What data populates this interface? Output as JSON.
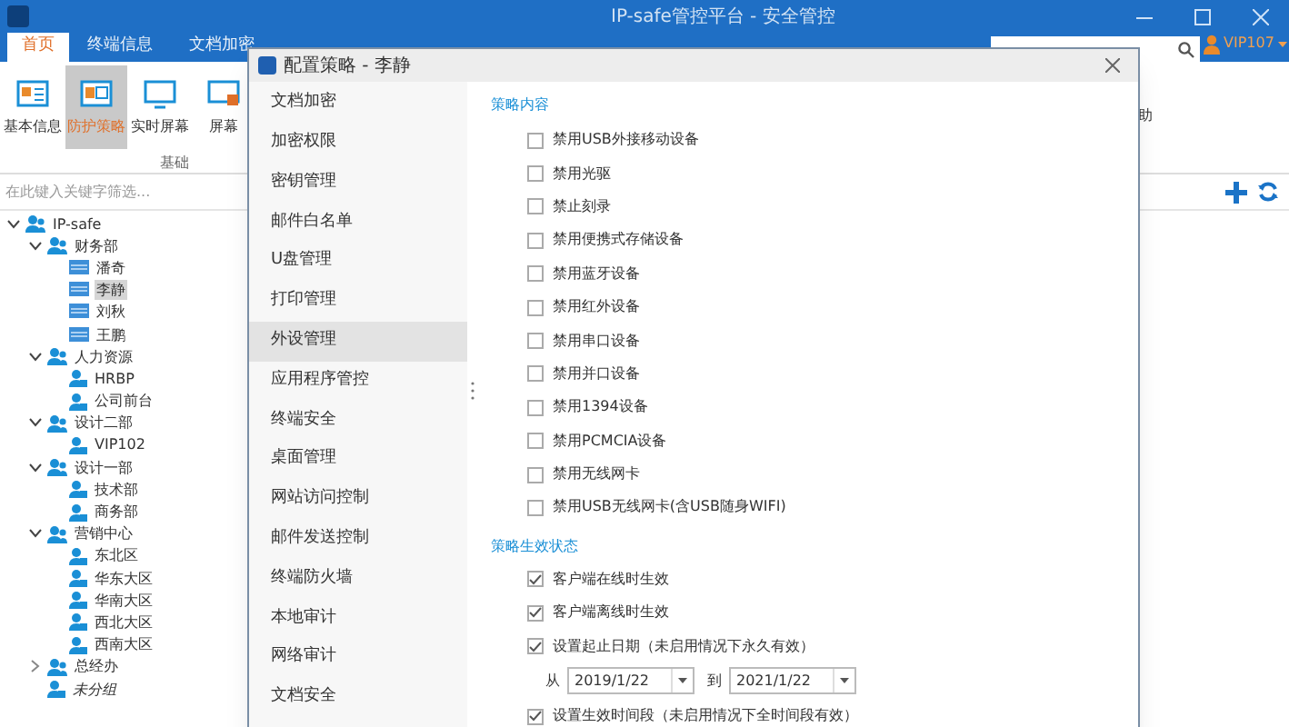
{
  "window": {
    "title": "IP-safe管控平台 - 安全管控",
    "user": "VIP107"
  },
  "tabs": [
    {
      "label": "首页",
      "selected": true
    },
    {
      "label": "终端信息",
      "selected": false
    },
    {
      "label": "文档加密",
      "selected": false
    }
  ],
  "ribbon": {
    "buttons": [
      {
        "label": "基本信息",
        "selected": false,
        "kind": "info"
      },
      {
        "label": "防护策略",
        "selected": true,
        "kind": "policy"
      },
      {
        "label": "实时屏幕",
        "selected": false,
        "kind": "screen"
      },
      {
        "label": "屏幕",
        "selected": false,
        "kind": "screen2"
      }
    ],
    "group_label": "基础",
    "right_button": "助"
  },
  "filter": {
    "placeholder": "在此键入关键字筛选..."
  },
  "tree": [
    {
      "label": "IP-safe",
      "kind": "group",
      "expanded": true,
      "selected": false,
      "children": [
        {
          "label": "财务部",
          "kind": "group",
          "expanded": true,
          "selected": false,
          "children": [
            {
              "label": "潘奇",
              "kind": "terminal",
              "selected": false
            },
            {
              "label": "李静",
              "kind": "terminal",
              "selected": true
            },
            {
              "label": "刘秋",
              "kind": "terminal",
              "selected": false
            },
            {
              "label": "王鹏",
              "kind": "terminal",
              "selected": false
            }
          ]
        },
        {
          "label": "人力资源",
          "kind": "group",
          "expanded": true,
          "selected": false,
          "children": [
            {
              "label": "HRBP",
              "kind": "user",
              "selected": false
            },
            {
              "label": "公司前台",
              "kind": "user",
              "selected": false
            }
          ]
        },
        {
          "label": "设计二部",
          "kind": "group",
          "expanded": true,
          "selected": false,
          "children": [
            {
              "label": "VIP102",
              "kind": "user",
              "selected": false
            }
          ]
        },
        {
          "label": "设计一部",
          "kind": "group",
          "expanded": true,
          "selected": false,
          "children": [
            {
              "label": "技术部",
              "kind": "user",
              "selected": false
            },
            {
              "label": "商务部",
              "kind": "user",
              "selected": false
            }
          ]
        },
        {
          "label": "营销中心",
          "kind": "group",
          "expanded": true,
          "selected": false,
          "children": [
            {
              "label": "东北区",
              "kind": "user",
              "selected": false
            },
            {
              "label": "华东大区",
              "kind": "user",
              "selected": false
            },
            {
              "label": "华南大区",
              "kind": "user",
              "selected": false
            },
            {
              "label": "西北大区",
              "kind": "user",
              "selected": false
            },
            {
              "label": "西南大区",
              "kind": "user",
              "selected": false
            }
          ]
        },
        {
          "label": "总经办",
          "kind": "group",
          "expanded": false,
          "selected": false
        },
        {
          "label": "未分组",
          "kind": "ungrouped",
          "selected": false
        }
      ]
    }
  ],
  "dialog": {
    "title": "配置策略 - 李静",
    "nav": [
      {
        "label": "文档加密",
        "selected": false
      },
      {
        "label": "加密权限",
        "selected": false
      },
      {
        "label": "密钥管理",
        "selected": false
      },
      {
        "label": "邮件白名单",
        "selected": false
      },
      {
        "label": "U盘管理",
        "selected": false
      },
      {
        "label": "打印管理",
        "selected": false
      },
      {
        "label": "外设管理",
        "selected": true
      },
      {
        "label": "应用程序管控",
        "selected": false
      },
      {
        "label": "终端安全",
        "selected": false
      },
      {
        "label": "桌面管理",
        "selected": false
      },
      {
        "label": "网站访问控制",
        "selected": false
      },
      {
        "label": "邮件发送控制",
        "selected": false
      },
      {
        "label": "终端防火墙",
        "selected": false
      },
      {
        "label": "本地审计",
        "selected": false
      },
      {
        "label": "网络审计",
        "selected": false
      },
      {
        "label": "文档安全",
        "selected": false
      }
    ],
    "content_heading": "策略内容",
    "options": [
      {
        "label": "禁用USB外接移动设备",
        "checked": false
      },
      {
        "label": "禁用光驱",
        "checked": false
      },
      {
        "label": "禁止刻录",
        "checked": false
      },
      {
        "label": "禁用便携式存储设备",
        "checked": false
      },
      {
        "label": "禁用蓝牙设备",
        "checked": false
      },
      {
        "label": "禁用红外设备",
        "checked": false
      },
      {
        "label": "禁用串口设备",
        "checked": false
      },
      {
        "label": "禁用并口设备",
        "checked": false
      },
      {
        "label": "禁用1394设备",
        "checked": false
      },
      {
        "label": "禁用PCMCIA设备",
        "checked": false
      },
      {
        "label": "禁用无线网卡",
        "checked": false
      },
      {
        "label": "禁用USB无线网卡(含USB随身WIFI)",
        "checked": false
      }
    ],
    "status_heading": "策略生效状态",
    "status_options": [
      {
        "label": "客户端在线时生效",
        "checked": true
      },
      {
        "label": "客户端离线时生效",
        "checked": true
      },
      {
        "label": "设置起止日期（未启用情况下永久有效）",
        "checked": true
      }
    ],
    "date_range": {
      "from_label": "从",
      "from": "2019/1/22",
      "to_label": "到",
      "to": "2021/1/22"
    },
    "last_option": {
      "label": "设置生效时间段（未启用情况下全时间段有效）",
      "checked": true
    }
  }
}
